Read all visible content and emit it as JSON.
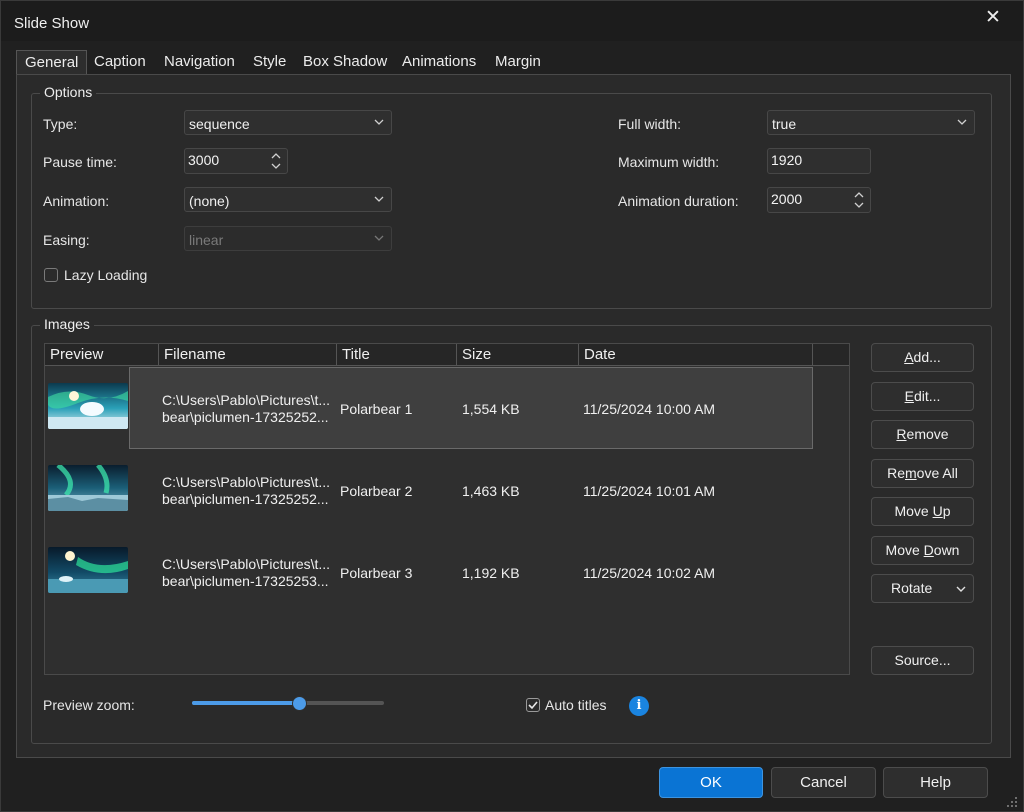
{
  "window": {
    "title": "Slide Show",
    "close_glyph": "✕"
  },
  "tabs": [
    {
      "label": "General",
      "active": true
    },
    {
      "label": "Caption"
    },
    {
      "label": "Navigation"
    },
    {
      "label": "Style"
    },
    {
      "label": "Box Shadow"
    },
    {
      "label": "Animations"
    },
    {
      "label": "Margin"
    }
  ],
  "options": {
    "group_title": "Options",
    "type": {
      "label": "Type:",
      "value": "sequence"
    },
    "pause_time": {
      "label": "Pause time:",
      "value": "3000"
    },
    "animation": {
      "label": "Animation:",
      "value": "(none)"
    },
    "easing": {
      "label": "Easing:",
      "value": "linear",
      "disabled": true
    },
    "lazy_loading": {
      "label": "Lazy Loading",
      "checked": false
    },
    "full_width": {
      "label": "Full width:",
      "value": "true"
    },
    "maximum_width": {
      "label": "Maximum width:",
      "value": "1920"
    },
    "animation_duration": {
      "label": "Animation duration:",
      "value": "2000"
    }
  },
  "images": {
    "group_title": "Images",
    "columns": [
      "Preview",
      "Filename",
      "Title",
      "Size",
      "Date"
    ],
    "rows": [
      {
        "filename_line1": "C:\\Users\\Pablo\\Pictures\\t...",
        "filename_line2": "bear\\piclumen-17325252...",
        "title": "Polarbear 1",
        "size": "1,554 KB",
        "date": "11/25/2024 10:00 AM",
        "selected": true
      },
      {
        "filename_line1": "C:\\Users\\Pablo\\Pictures\\t...",
        "filename_line2": "bear\\piclumen-17325252...",
        "title": "Polarbear 2",
        "size": "1,463 KB",
        "date": "11/25/2024 10:01 AM"
      },
      {
        "filename_line1": "C:\\Users\\Pablo\\Pictures\\t...",
        "filename_line2": "bear\\piclumen-17325253...",
        "title": "Polarbear 3",
        "size": "1,192 KB",
        "date": "11/25/2024 10:02 AM"
      }
    ],
    "buttons": {
      "add": {
        "pre": "",
        "key": "A",
        "post": "dd..."
      },
      "edit": {
        "pre": "",
        "key": "E",
        "post": "dit..."
      },
      "remove": {
        "pre": "",
        "key": "R",
        "post": "emove"
      },
      "remove_all": {
        "pre": "Re",
        "key": "m",
        "post": "ove All"
      },
      "move_up": {
        "pre": "Move ",
        "key": "U",
        "post": "p"
      },
      "move_down": {
        "pre": "Move ",
        "key": "D",
        "post": "own"
      },
      "rotate": {
        "label": "Rotate"
      },
      "source": {
        "label": "Source..."
      }
    },
    "preview_zoom": {
      "label": "Preview zoom:",
      "value_percent": 55
    },
    "auto_titles": {
      "label": "Auto titles",
      "checked": true
    },
    "info_glyph": "i"
  },
  "footer": {
    "ok": "OK",
    "cancel": "Cancel",
    "help": "Help"
  },
  "colors": {
    "accent": "#0a74d4",
    "slider": "#4c9be8",
    "info": "#1a84e0"
  },
  "icons": [
    "close-icon",
    "chevron-down-icon",
    "spin-arrows-icon",
    "checkmark-icon",
    "info-icon",
    "resize-grip-icon"
  ]
}
